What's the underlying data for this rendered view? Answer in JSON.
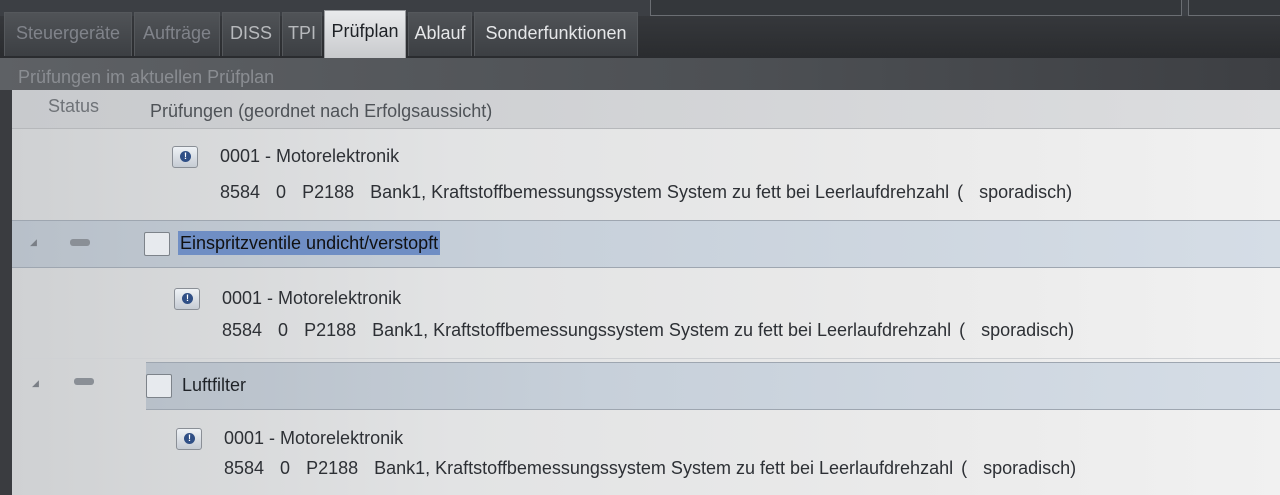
{
  "tabs": [
    {
      "label": "Steuergeräte",
      "state": "faded"
    },
    {
      "label": "Aufträge",
      "state": "faded"
    },
    {
      "label": "DISS",
      "state": "normal"
    },
    {
      "label": "TPI",
      "state": "normal"
    },
    {
      "label": "Prüfplan",
      "state": "active"
    },
    {
      "label": "Ablauf",
      "state": "bright"
    },
    {
      "label": "Sonderfunktionen",
      "state": "bright"
    }
  ],
  "section_title": "Prüfungen im aktuellen Prüfplan",
  "columns": {
    "status": "Status",
    "pruefungen": "Prüfungen (geordnet nach Erfolgsaussicht)"
  },
  "entries": [
    {
      "module": "0001 - Motorelektronik",
      "code1": "8584",
      "code2": "0",
      "dtc": "P2188",
      "description": "Bank1, Kraftstoffbemessungssystem System zu fett bei Leerlaufdrehzahl",
      "paren": "(",
      "freq": "sporadisch)"
    },
    {
      "group": "Einspritzventile undicht/verstopft",
      "module": "0001 - Motorelektronik",
      "code1": "8584",
      "code2": "0",
      "dtc": "P2188",
      "description": "Bank1, Kraftstoffbemessungssystem System zu fett bei Leerlaufdrehzahl",
      "paren": "(",
      "freq": "sporadisch)"
    },
    {
      "group": "Luftfilter",
      "module": "0001 - Motorelektronik",
      "code1": "8584",
      "code2": "0",
      "dtc": "P2188",
      "description": "Bank1, Kraftstoffbemessungssystem System zu fett bei Leerlaufdrehzahl",
      "paren": "(",
      "freq": "sporadisch)"
    }
  ],
  "colors": {
    "selection": "#6f8ec4",
    "group_band": "#c7d0da",
    "active_tab": "#e9eaec"
  }
}
